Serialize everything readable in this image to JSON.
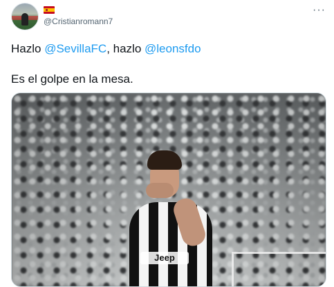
{
  "author": {
    "handle": "@Cristianromann7",
    "flag": "spain-flag-icon",
    "avatar": "avatar"
  },
  "header": {
    "more_icon": "···"
  },
  "tweet": {
    "prefix": "Hazlo ",
    "mention1": "@SevillaFC",
    "middle": ", hazlo ",
    "mention2": "@leonsfdo",
    "line2": "Es el golpe en la mesa."
  },
  "media": {
    "sponsor_text": "Jeep"
  },
  "colors": {
    "mention": "#1d9bf0",
    "secondary_text": "#536471",
    "border": "#cfd9de"
  }
}
